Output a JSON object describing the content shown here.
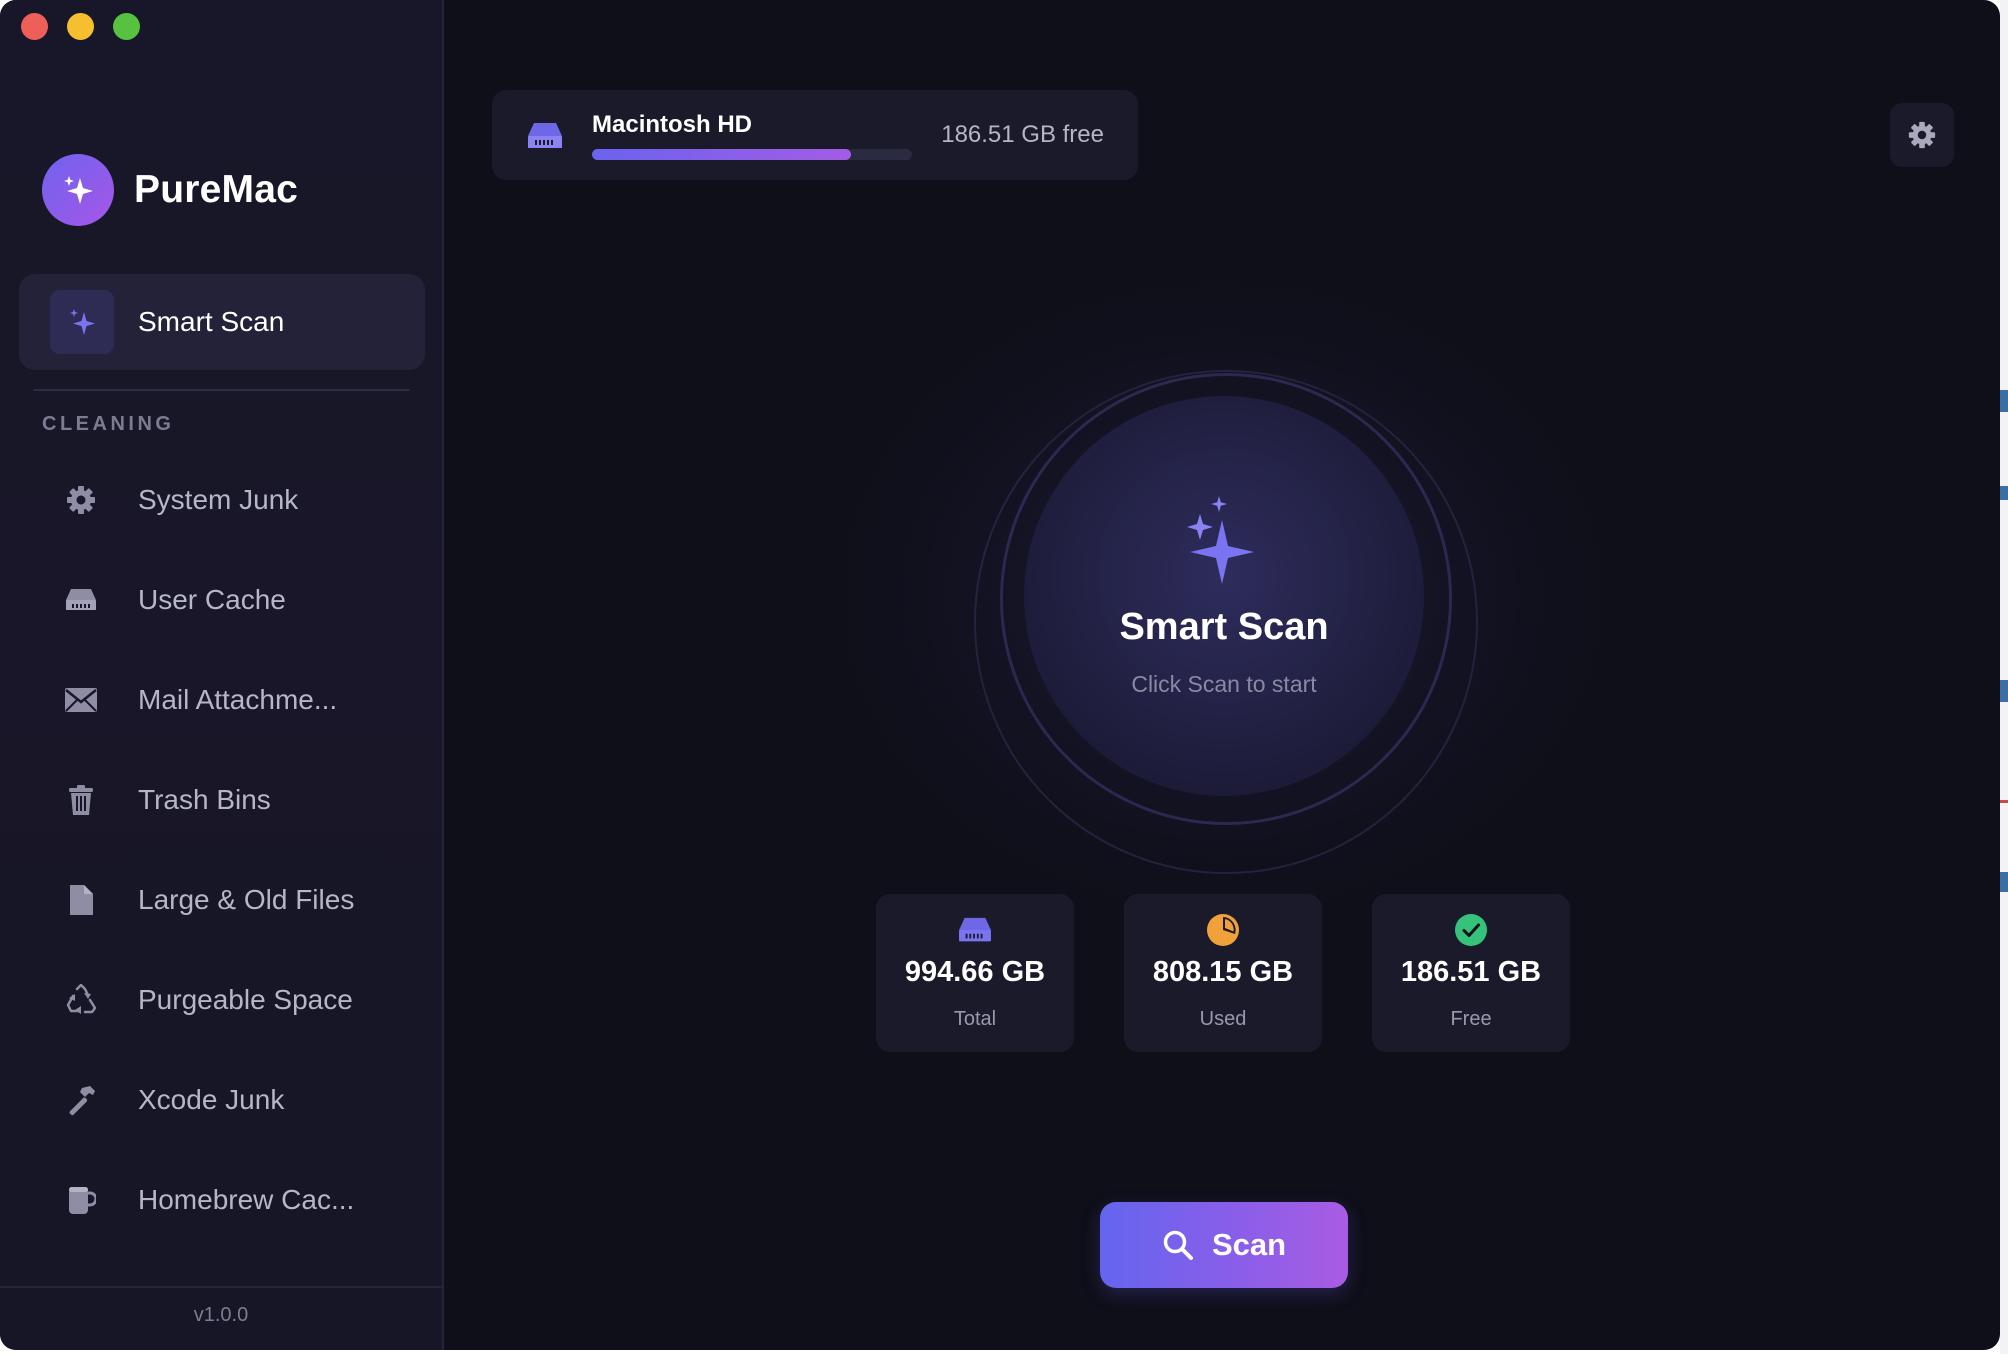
{
  "app": {
    "name": "PureMac",
    "version": "v1.0.0"
  },
  "window_controls": [
    "close",
    "minimize",
    "zoom"
  ],
  "sidebar": {
    "active_item": {
      "label": "Smart Scan",
      "icon": "sparkles-icon"
    },
    "section_title": "CLEANING",
    "items": [
      {
        "label": "System Junk",
        "icon": "gear-icon"
      },
      {
        "label": "User Cache",
        "icon": "drive-icon"
      },
      {
        "label": "Mail Attachme...",
        "icon": "envelope-icon"
      },
      {
        "label": "Trash Bins",
        "icon": "trash-icon"
      },
      {
        "label": "Large & Old Files",
        "icon": "document-icon"
      },
      {
        "label": "Purgeable Space",
        "icon": "recycle-icon"
      },
      {
        "label": "Xcode Junk",
        "icon": "hammer-icon"
      },
      {
        "label": "Homebrew Cac...",
        "icon": "mug-icon"
      }
    ]
  },
  "disk": {
    "name": "Macintosh HD",
    "free_text": "186.51 GB free",
    "used_fraction": 0.81
  },
  "hero": {
    "title": "Smart Scan",
    "subtitle": "Click Scan to start"
  },
  "stats": [
    {
      "value": "994.66 GB",
      "label": "Total",
      "icon": "drive-icon",
      "color": "#7b74f2"
    },
    {
      "value": "808.15 GB",
      "label": "Used",
      "icon": "pie-chart-icon",
      "color": "#f0a13a"
    },
    {
      "value": "186.51 GB",
      "label": "Free",
      "icon": "checkmark-circle-icon",
      "color": "#35c27a"
    }
  ],
  "scan_button": {
    "label": "Scan",
    "icon": "search-icon"
  },
  "colors": {
    "accent": "#7b74f2",
    "accent_end": "#a656e8",
    "background": "#0f0f19",
    "sidebar": "#181729",
    "card": "#1a1a2a"
  }
}
